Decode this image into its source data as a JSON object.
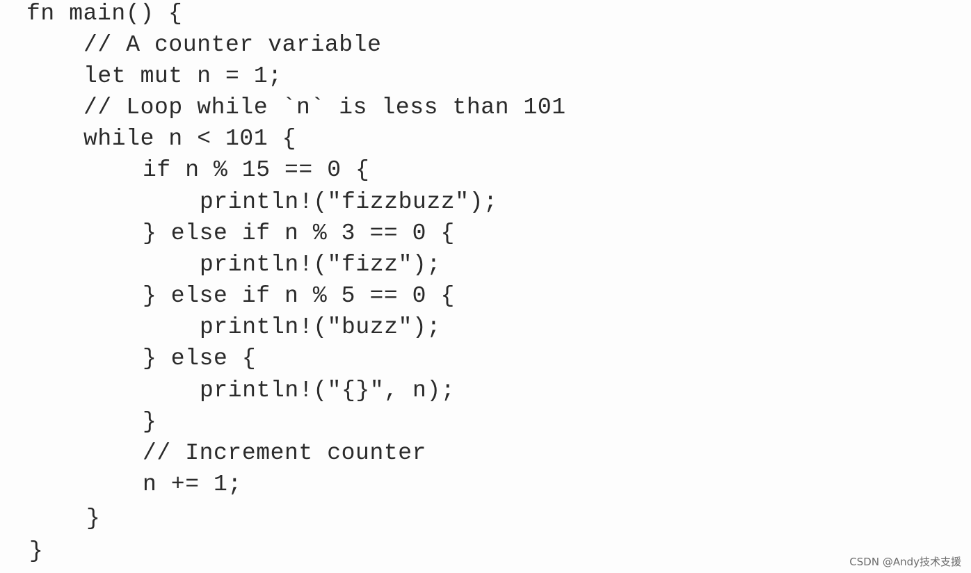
{
  "code_lines": [
    {
      "indent": 0,
      "text": "fn main() {"
    },
    {
      "indent": 1,
      "text": "// A counter variable"
    },
    {
      "indent": 1,
      "text": "let mut n = 1;"
    },
    {
      "indent": 1,
      "text": "// Loop while `n` is less than 101"
    },
    {
      "indent": 1,
      "text": "while n < 101 {"
    },
    {
      "indent": 2,
      "text": "if n % 15 == 0 {"
    },
    {
      "indent": 3,
      "text": "println!(\"fizzbuzz\");"
    },
    {
      "indent": 2,
      "text": "} else if n % 3 == 0 {"
    },
    {
      "indent": 3,
      "text": "println!(\"fizz\");"
    },
    {
      "indent": 2,
      "text": "} else if n % 5 == 0 {"
    },
    {
      "indent": 3,
      "text": "println!(\"buzz\");"
    },
    {
      "indent": 2,
      "text": "} else {"
    },
    {
      "indent": 3,
      "text": "println!(\"{}\", n);"
    },
    {
      "indent": 2,
      "text": "}"
    },
    {
      "indent": 2,
      "text": "// Increment counter"
    },
    {
      "indent": 2,
      "text": "n += 1;"
    },
    {
      "indent": 1,
      "text": "}"
    },
    {
      "indent": 0,
      "text": "}"
    }
  ],
  "watermark": "CSDN @Andy技术支援"
}
